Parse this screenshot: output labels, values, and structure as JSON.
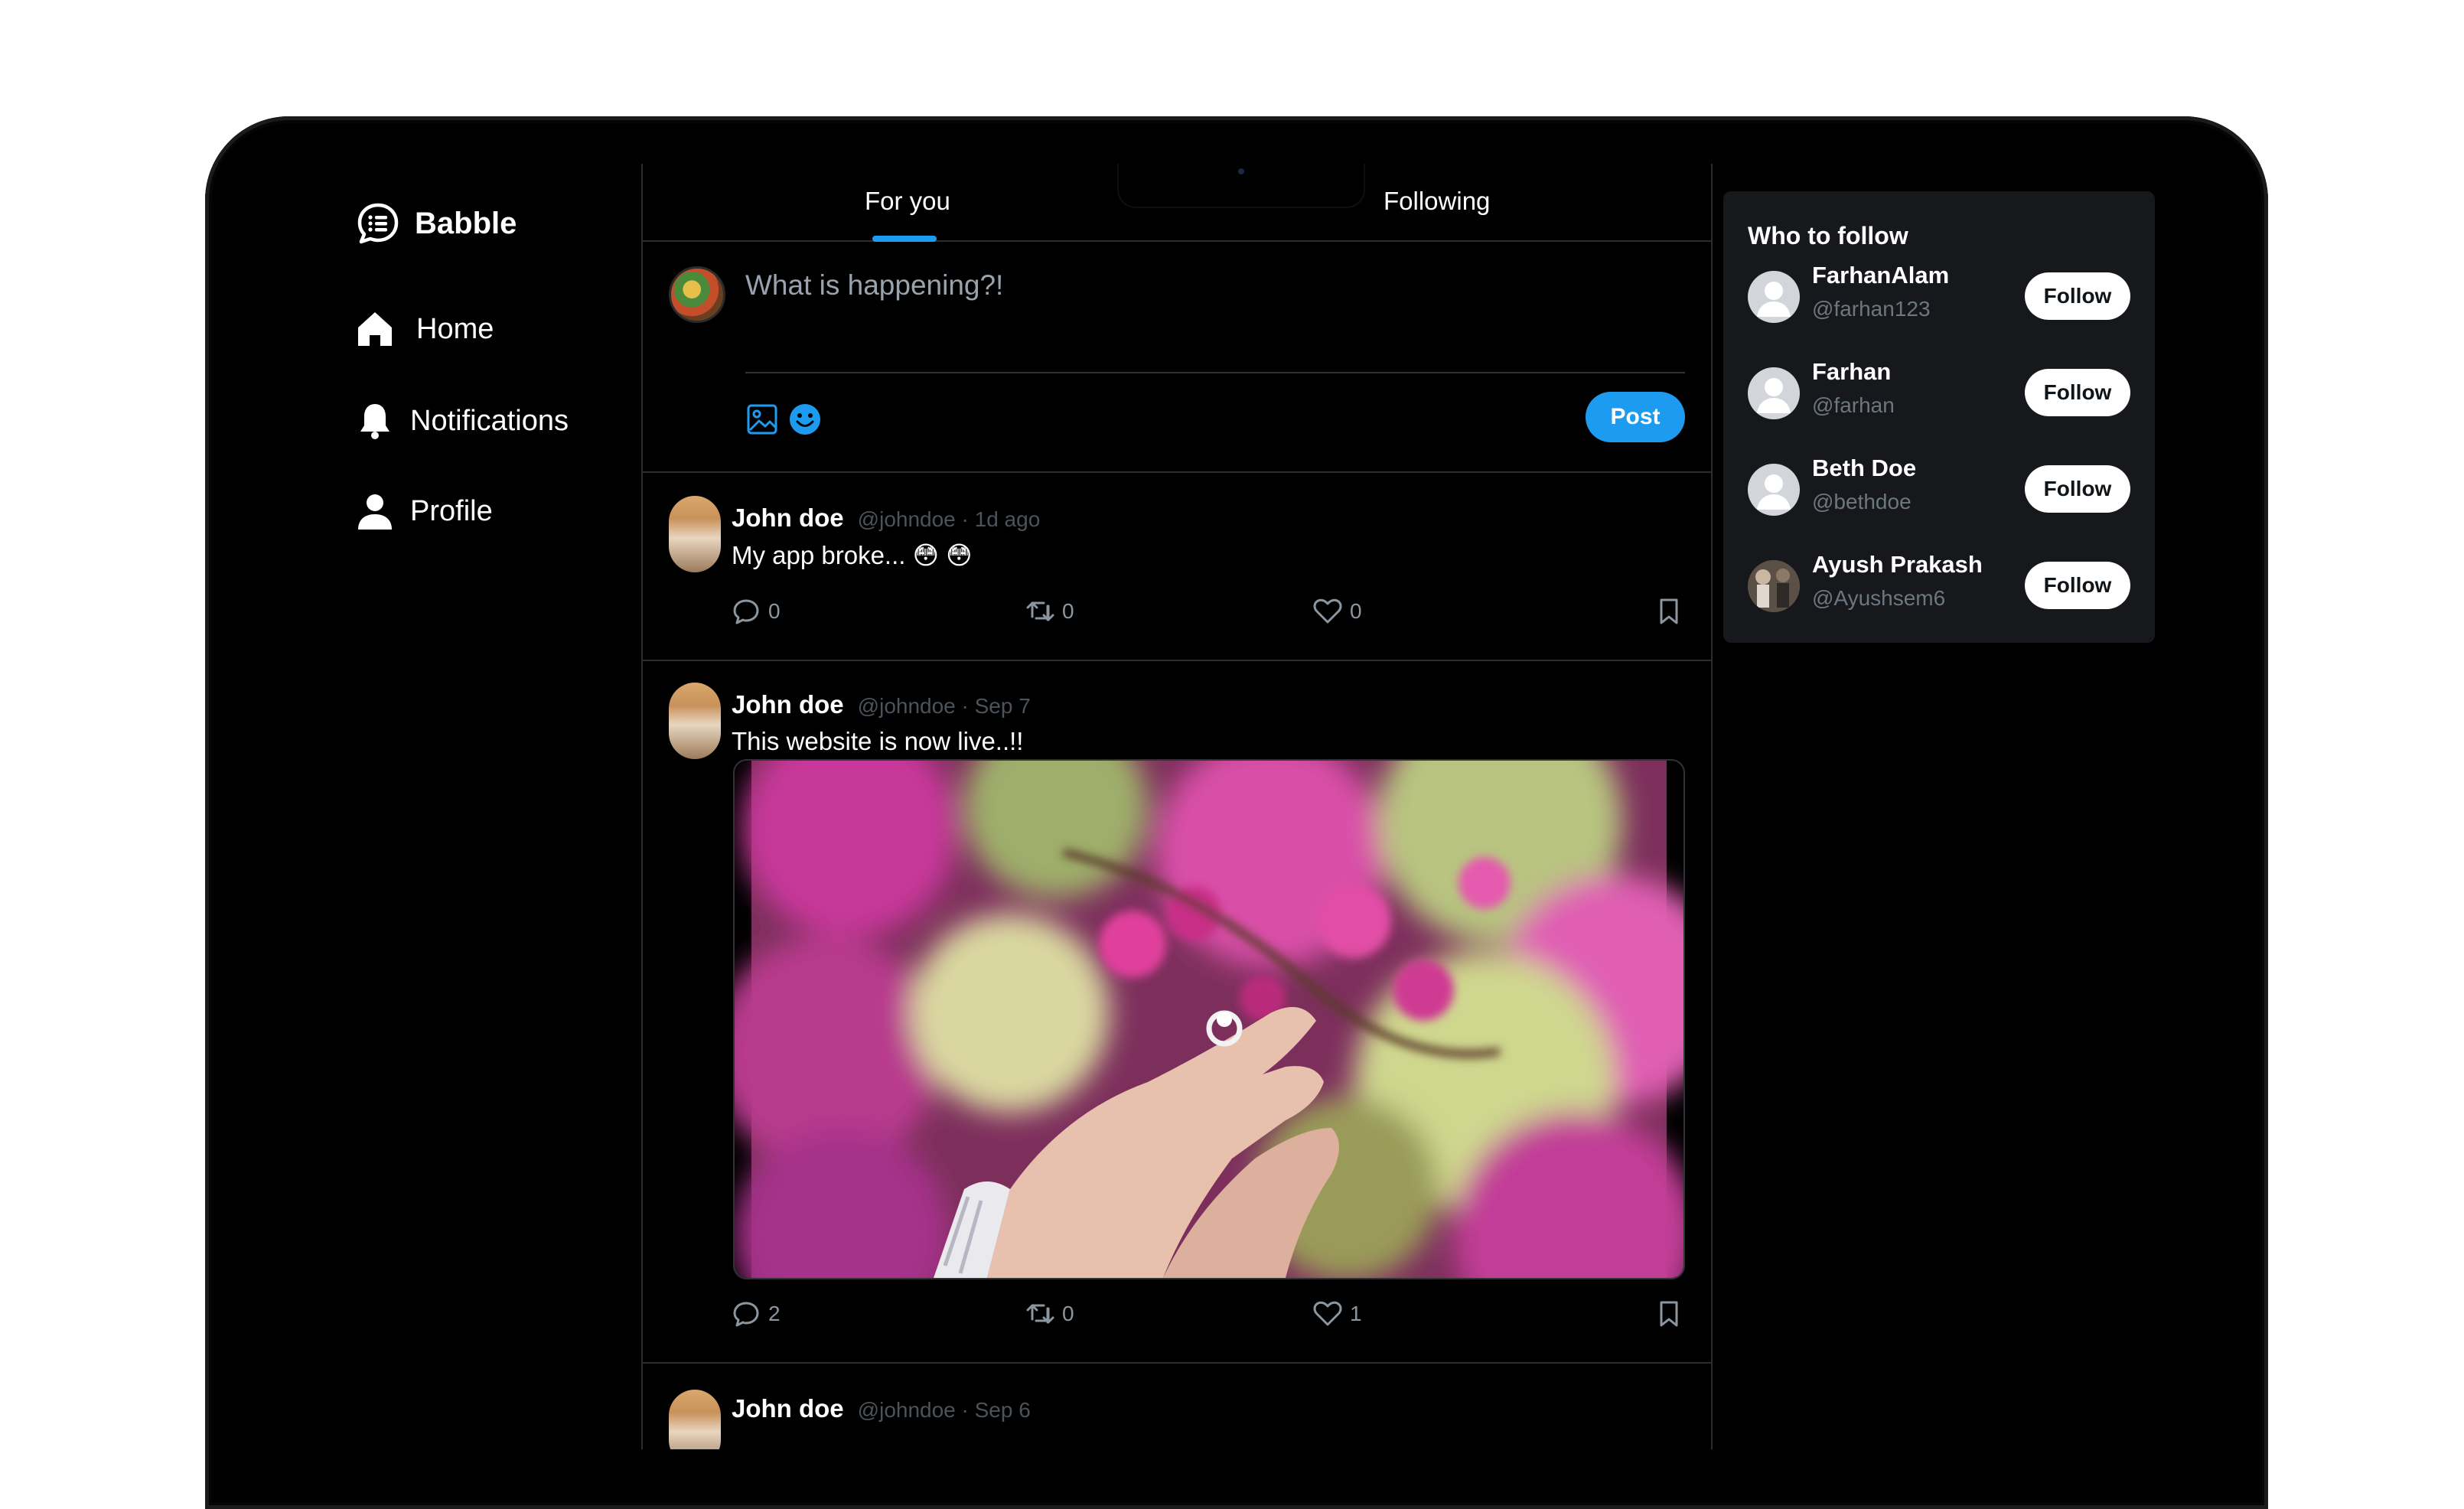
{
  "app": {
    "name": "Babble"
  },
  "nav": [
    {
      "label": "Home",
      "icon": "home-icon"
    },
    {
      "label": "Notifications",
      "icon": "bell-icon"
    },
    {
      "label": "Profile",
      "icon": "user-icon"
    }
  ],
  "tabs": {
    "for_you": "For you",
    "following": "Following",
    "active": "For you"
  },
  "composer": {
    "placeholder": "What is happening?!",
    "post_label": "Post",
    "icons": [
      "image-icon",
      "emoji-icon"
    ]
  },
  "posts": [
    {
      "author": "John doe",
      "meta": "@johndoe · 1d ago",
      "text": "My app broke... 😳 😳",
      "replies": "0",
      "reposts": "0",
      "likes": "0"
    },
    {
      "author": "John doe",
      "meta": "@johndoe · Sep 7",
      "text": "This website is now live..!!",
      "replies": "2",
      "reposts": "0",
      "likes": "1"
    },
    {
      "author": "John doe",
      "meta": "@johndoe · Sep 6"
    }
  ],
  "who_to_follow": {
    "title": "Who to follow",
    "users": [
      {
        "name": "FarhanAlam",
        "handle": "@farhan123",
        "button": "Follow"
      },
      {
        "name": "Farhan",
        "handle": "@farhan",
        "button": "Follow"
      },
      {
        "name": "Beth Doe",
        "handle": "@bethdoe",
        "button": "Follow"
      },
      {
        "name": "Ayush Prakash",
        "handle": "@Ayushsem6",
        "button": "Follow"
      }
    ]
  },
  "colors": {
    "accent": "#1d9bf0",
    "background": "#000000",
    "card": "#16181c",
    "muted": "#4b535b"
  }
}
